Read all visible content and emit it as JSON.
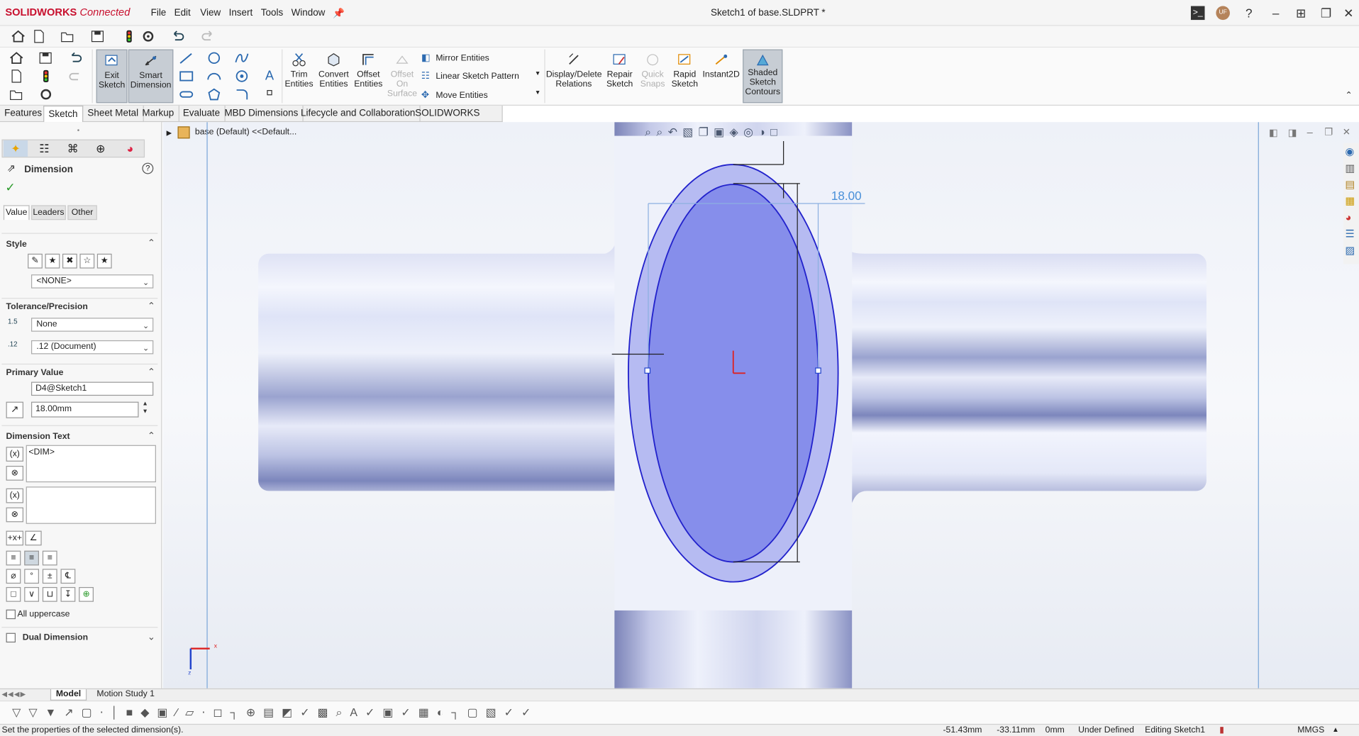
{
  "app": {
    "brand": "SOLIDWORKS",
    "brand_suffix": "Connected",
    "doc_title": "Sketch1 of base.SLDPRT *",
    "user_initials": "UF"
  },
  "menu": [
    "File",
    "Edit",
    "View",
    "Insert",
    "Tools",
    "Window"
  ],
  "commands": {
    "exit_sketch": "Exit\nSketch",
    "smart_dimension": "Smart\nDimension",
    "trim": "Trim\nEntities",
    "convert": "Convert\nEntities",
    "offset": "Offset\nEntities",
    "offset_surface": "Offset\nOn\nSurface",
    "mirror": "Mirror Entities",
    "linear_pattern": "Linear Sketch Pattern",
    "move": "Move Entities",
    "display_delete": "Display/Delete\nRelations",
    "repair": "Repair\nSketch",
    "quick_snaps": "Quick\nSnaps",
    "rapid_sketch": "Rapid\nSketch",
    "instant2d": "Instant2D",
    "shaded_contours": "Shaded\nSketch\nContours"
  },
  "tabs": [
    "Features",
    "Sketch",
    "Sheet Metal",
    "Markup",
    "Evaluate",
    "MBD Dimensions",
    "Lifecycle and Collaboration",
    "SOLIDWORKS Add-Ins"
  ],
  "active_tab": "Sketch",
  "pm": {
    "title": "Dimension",
    "subtabs": [
      "Value",
      "Leaders",
      "Other"
    ],
    "style_title": "Style",
    "style_value": "<NONE>",
    "tol_title": "Tolerance/Precision",
    "tol_value": "None",
    "precision_value": ".12 (Document)",
    "primary_title": "Primary Value",
    "primary_name": "D4@Sketch1",
    "primary_value": "18.00mm",
    "dimtext_title": "Dimension Text",
    "dimtext_value": "<DIM>",
    "all_uppercase": "All uppercase",
    "dual_dimension": "Dual Dimension"
  },
  "tree": {
    "node": "base (Default) <<Default..."
  },
  "viewport": {
    "dimension_label": "18.00"
  },
  "bottom_tabs": [
    "Model",
    "Motion Study 1"
  ],
  "status": {
    "message": "Set the properties of the selected dimension(s).",
    "x": "-51.43mm",
    "y": "-33.11mm",
    "z": "0mm",
    "state": "Under Defined",
    "mode": "Editing Sketch1",
    "units": "MMGS"
  }
}
